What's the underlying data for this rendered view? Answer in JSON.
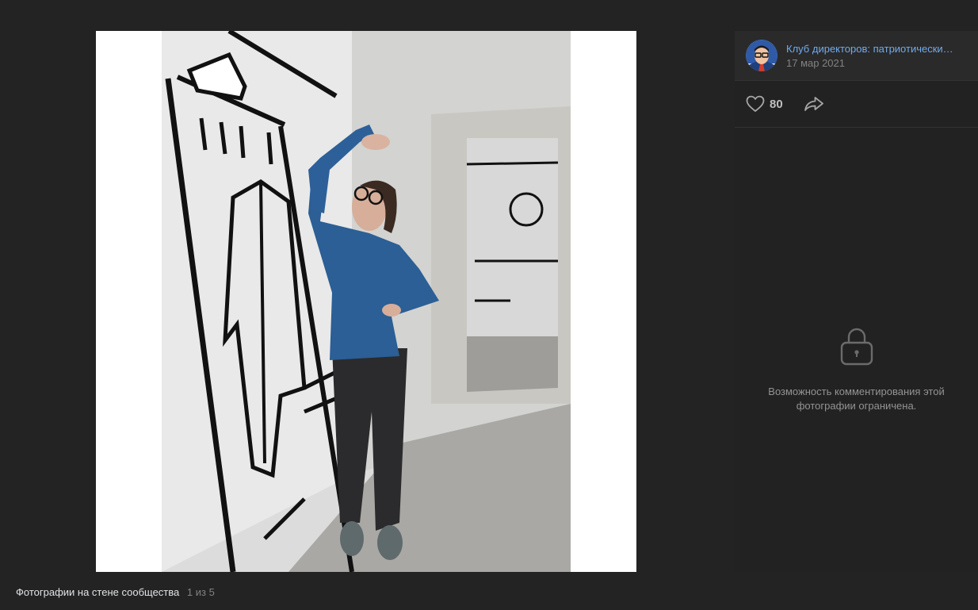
{
  "author": {
    "name": "Клуб директоров: патриотически…",
    "date": "17 мар 2021"
  },
  "actions": {
    "likes_count": "80"
  },
  "comments": {
    "restricted_text": "Возможность комментирования этой фотографии ограничена."
  },
  "caption": {
    "title": "Фотографии на стене сообщества",
    "counter": "1 из 5"
  },
  "colors": {
    "background": "#232323",
    "panel": "#222222",
    "link": "#71aaeb",
    "muted": "#828282"
  },
  "icons": [
    "heart-icon",
    "share-icon",
    "lock-icon"
  ]
}
